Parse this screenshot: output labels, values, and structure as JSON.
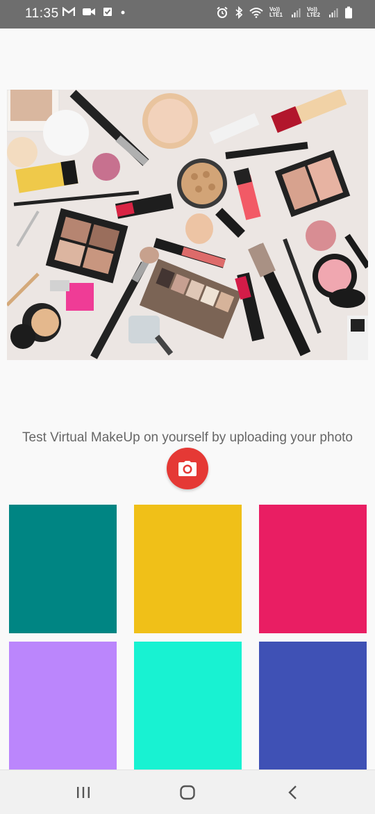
{
  "status_bar": {
    "time": "11:35",
    "left_icons": [
      "gmail-icon",
      "video-icon",
      "checkbox-icon",
      "dot-icon"
    ],
    "right_icons": [
      "alarm-icon",
      "bluetooth-icon",
      "wifi-icon",
      "signal-icon",
      "battery-icon"
    ],
    "lte1": "Vo)) LTE1",
    "lte2": "Vo)) LTE2"
  },
  "hero": {
    "icon": "makeup-products-image"
  },
  "main": {
    "caption": "Test Virtual MakeUp on yourself by uploading your photo",
    "camera_button_icon": "camera-icon"
  },
  "swatches": [
    {
      "color": "#008583"
    },
    {
      "color": "#f0c018"
    },
    {
      "color": "#e91e63"
    },
    {
      "color": "#bb86fc"
    },
    {
      "color": "#18f2d2"
    },
    {
      "color": "#3f51b5"
    }
  ],
  "nav_bar": {
    "icons": [
      "recent-apps-icon",
      "home-icon",
      "back-icon"
    ]
  }
}
